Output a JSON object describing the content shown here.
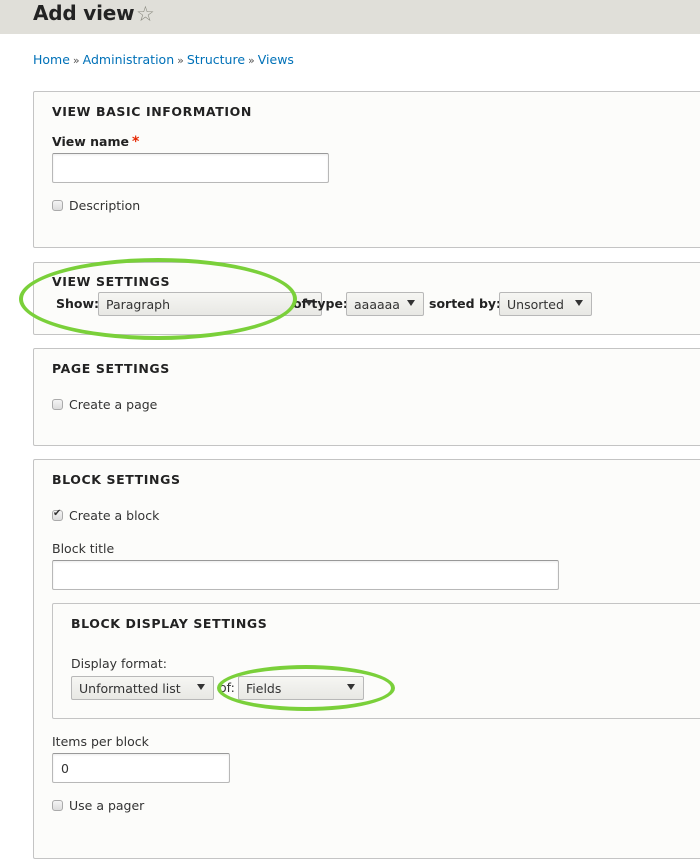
{
  "header": {
    "title": "Add view",
    "star_icon": "☆"
  },
  "breadcrumb": {
    "items": [
      "Home",
      "Administration",
      "Structure",
      "Views"
    ],
    "separator": "»"
  },
  "basic_info": {
    "legend": "View basic information",
    "view_name_label": "View name",
    "required_marker": "*",
    "view_name_value": "",
    "description_label": "Description",
    "description_checked": false
  },
  "view_settings": {
    "legend": "View settings",
    "show_label": "Show:",
    "show_value": "Paragraph",
    "of_type_label": "of type:",
    "of_type_value": "aaaaaa",
    "sorted_by_label": "sorted by:",
    "sorted_by_value": "Unsorted"
  },
  "page_settings": {
    "legend": "Page settings",
    "create_page_label": "Create a page",
    "create_page_checked": false
  },
  "block_settings": {
    "legend": "Block settings",
    "create_block_label": "Create a block",
    "create_block_checked": true,
    "block_title_label": "Block title",
    "block_title_value": "",
    "display": {
      "legend": "Block display settings",
      "format_label": "Display format:",
      "format_value": "Unformatted list",
      "of_label": "of:",
      "of_value": "Fields"
    },
    "items_per_block_label": "Items per block",
    "items_per_block_value": "0",
    "use_pager_label": "Use a pager",
    "use_pager_checked": false
  },
  "annotations": {
    "highlight_color": "#7ad03a"
  }
}
